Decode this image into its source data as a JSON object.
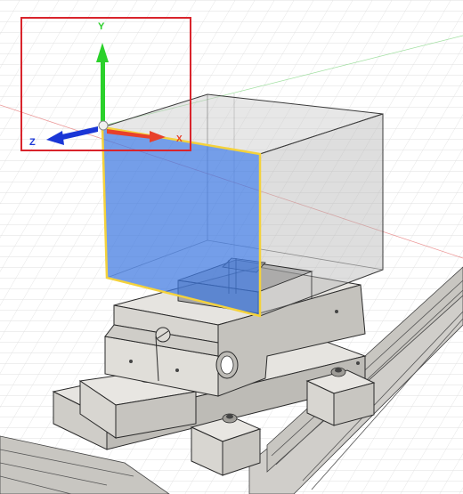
{
  "viewport": {
    "triad": {
      "y_label": "Y",
      "x_label": "X",
      "z_label": "Z"
    },
    "colors": {
      "background": "#ffffff",
      "grid_line": "#dcdcdc",
      "x_axis": "#e8402a",
      "y_axis": "#2bd12b",
      "z_axis": "#1a36d6",
      "highlight_frame": "#d9242c",
      "selected_face": "#3f79e0",
      "selected_edge": "#f4d23c",
      "body_edge": "#2a2a2a",
      "part_light": "#e6e4e0",
      "part_mid": "#cfcdc8",
      "part_dark": "#a9a7a2",
      "rail": "#cac8c3"
    },
    "selection": {
      "type": "planar-face",
      "state": "selected"
    },
    "icons": [
      "y-axis-arrow-icon",
      "z-axis-arrow-icon",
      "x-axis-arrow-icon",
      "origin-sphere-icon"
    ]
  }
}
